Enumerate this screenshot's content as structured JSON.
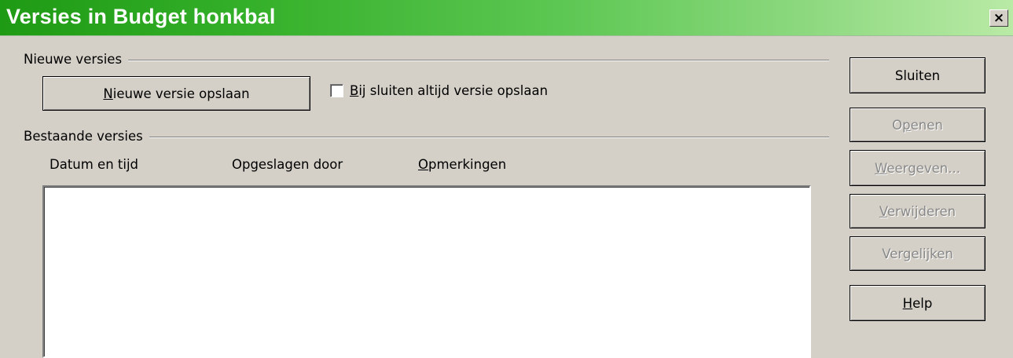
{
  "window": {
    "title": "Versies in Budget honkbal",
    "close_glyph": "×"
  },
  "new_versions": {
    "group_label": "Nieuwe versies",
    "save_button": {
      "label_pre": "",
      "mnemonic": "N",
      "label_post": "ieuwe versie opslaan"
    },
    "checkbox": {
      "label_pre": "",
      "mnemonic": "B",
      "label_post": "ij sluiten altijd versie opslaan",
      "checked": false
    }
  },
  "existing_versions": {
    "group_label": "Bestaande versies",
    "columns": [
      {
        "pre": "Datum en tijd",
        "mnemonic": "",
        "post": ""
      },
      {
        "pre": "Opgeslagen door",
        "mnemonic": "",
        "post": ""
      },
      {
        "pre": "",
        "mnemonic": "O",
        "post": "pmerkingen"
      }
    ],
    "rows": []
  },
  "side_buttons": {
    "close": {
      "label_pre": "Sluiten",
      "mnemonic": "",
      "label_post": "",
      "enabled": true
    },
    "open": {
      "label_pre": "O",
      "mnemonic": "p",
      "label_post": "enen",
      "enabled": false
    },
    "show": {
      "label_pre": "",
      "mnemonic": "W",
      "label_post": "eergeven...",
      "enabled": false
    },
    "delete": {
      "label_pre": "",
      "mnemonic": "V",
      "label_post": "erwijderen",
      "enabled": false
    },
    "compare": {
      "label_pre": "Vergeli",
      "mnemonic": "j",
      "label_post": "ken",
      "enabled": false
    },
    "help": {
      "label_pre": "",
      "mnemonic": "H",
      "label_post": "elp",
      "enabled": true
    }
  }
}
